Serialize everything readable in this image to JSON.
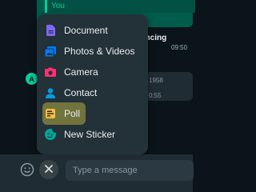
{
  "chat": {
    "reply_name": "You",
    "outgoing_text_fragment": "encing",
    "outgoing_time": "09:50",
    "incoming_text_fragment": "1958",
    "incoming_time": "0:55",
    "avatar_letter": "A"
  },
  "menu": {
    "items": [
      {
        "label": "Document",
        "icon": "document-icon",
        "color": "#7f66ff"
      },
      {
        "label": "Photos & Videos",
        "icon": "photos-videos-icon",
        "color": "#007bfc"
      },
      {
        "label": "Camera",
        "icon": "camera-icon",
        "color": "#ff2e74"
      },
      {
        "label": "Contact",
        "icon": "contact-icon",
        "color": "#009de2"
      },
      {
        "label": "Poll",
        "icon": "poll-icon",
        "color": "#ffbc38"
      },
      {
        "label": "New Sticker",
        "icon": "new-sticker-icon",
        "color": "#02a698"
      }
    ]
  },
  "composer": {
    "placeholder": "Type a message"
  }
}
